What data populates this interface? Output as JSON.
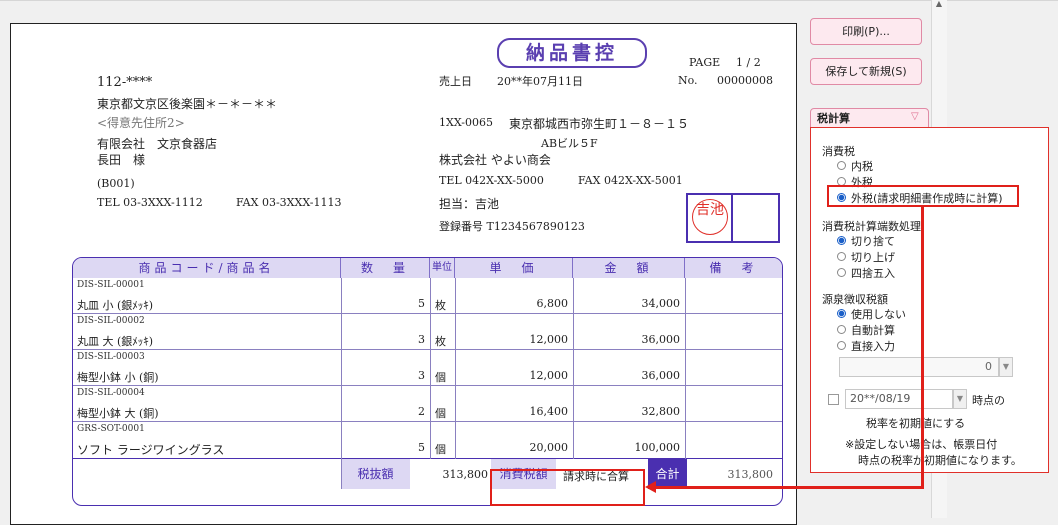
{
  "document": {
    "title": "納品書控",
    "page_label": "PAGE",
    "page_value": "1 / 2",
    "customer": {
      "postal": "112-****",
      "address": "東京都文京区後楽園＊－＊－＊＊",
      "address2_placeholder": "<得意先住所2>",
      "company": "有限会社　文京食器店",
      "person": "長田　様",
      "code": "(B001)",
      "tel": "TEL 03-3XXX-1112",
      "fax": "FAX 03-3XXX-1113"
    },
    "sales_date_label": "売上日",
    "sales_date": "20**年07月11日",
    "no_label": "No.",
    "no_value": "00000008",
    "issuer": {
      "postal": "1XX-0065",
      "address": "東京都城西市弥生町１－８－１５",
      "building": "ABビル５F",
      "company": "株式会社 やよい商会",
      "tel": "TEL 042X-XX-5000",
      "fax": "FAX 042X-XX-5001",
      "person": "担当：吉池",
      "reg": "登録番号 T1234567890123",
      "stamp": "吉池"
    },
    "table": {
      "headers": [
        "商品コード/商品名",
        "数　量",
        "単位",
        "単　価",
        "金　額",
        "備　考"
      ],
      "rows": [
        {
          "code": "DIS-SIL-00001",
          "name": "丸皿 小 (銀ﾒｯｷ)",
          "qty": "5",
          "unit": "枚",
          "price": "6,800",
          "amount": "34,000"
        },
        {
          "code": "DIS-SIL-00002",
          "name": "丸皿 大 (銀ﾒｯｷ)",
          "qty": "3",
          "unit": "枚",
          "price": "12,000",
          "amount": "36,000"
        },
        {
          "code": "DIS-SIL-00003",
          "name": "梅型小鉢 小 (銅)",
          "qty": "3",
          "unit": "個",
          "price": "12,000",
          "amount": "36,000"
        },
        {
          "code": "DIS-SIL-00004",
          "name": "梅型小鉢 大 (銅)",
          "qty": "2",
          "unit": "個",
          "price": "16,400",
          "amount": "32,800"
        },
        {
          "code": "GRS-SOT-0001",
          "name": "ソフト ラージワイングラス",
          "qty": "5",
          "unit": "個",
          "price": "20,000",
          "amount": "100,000"
        }
      ],
      "subtotal_label": "税抜額",
      "subtotal_value": "313,800",
      "tax_label": "消費税額",
      "tax_value": "請求時に合算",
      "total_label": "合計",
      "total_value": "313,800"
    }
  },
  "panel": {
    "print_button": "印刷(P)...",
    "save_new_button": "保存して新規(S)",
    "tax_calc_header": "税計算",
    "consumption_tax_title": "消費税",
    "consumption_tax_options": [
      "内税",
      "外税",
      "外税(請求明細書作成時に計算)"
    ],
    "rounding_title": "消費税計算端数処理",
    "rounding_options": [
      "切り捨て",
      "切り上げ",
      "四捨五入"
    ],
    "withholding_title": "源泉徴収税額",
    "withholding_options": [
      "使用しない",
      "自動計算",
      "直接入力"
    ],
    "withholding_amount": "0",
    "date_value": "20**/08/19",
    "date_suffix": "時点の",
    "date_note": "税率を初期値にする",
    "footnote1": "※設定しない場合は、帳票日付",
    "footnote2": "時点の税率が初期値になります。"
  },
  "colors": {
    "accent": "#4a2fb0",
    "highlight": "#e0201a",
    "panel_button": "#fde9ef"
  }
}
